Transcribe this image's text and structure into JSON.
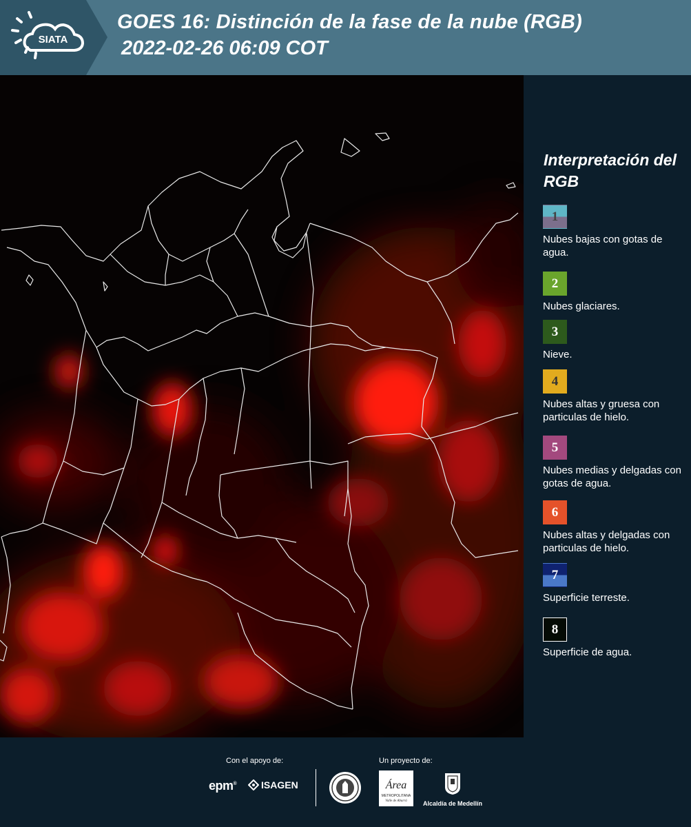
{
  "header": {
    "logo_text": "SIATA",
    "title_line1": "GOES 16: Distinción de la fase de la nube (RGB)",
    "title_line2": "2022-02-26 06:09 COT"
  },
  "legend": {
    "title": "Interpretación del RGB",
    "items": [
      {
        "number": "1",
        "label": "Nubes bajas con gotas de agua.",
        "color_top": "#5fb6c6",
        "color_bottom": "#7c6f8c",
        "number_color": "#444444"
      },
      {
        "number": "2",
        "label": "Nubes glaciares.",
        "color_top": "#6aa52c",
        "color_bottom": "#6aa52c",
        "number_color": "#ffffff"
      },
      {
        "number": "3",
        "label": "Nieve.",
        "color_top": "#2d5a1c",
        "color_bottom": "#2d5a1c",
        "number_color": "#ffffff"
      },
      {
        "number": "4",
        "label": "Nubes altas y gruesa con particulas de hielo.",
        "color_top": "#e2ab1e",
        "color_bottom": "#e2ab1e",
        "number_color": "#333333"
      },
      {
        "number": "5",
        "label": "Nubes medias y delgadas con gotas de agua.",
        "color_top": "#a3497e",
        "color_bottom": "#a3497e",
        "number_color": "#ffffff"
      },
      {
        "number": "6",
        "label": "Nubes altas y delgadas con particulas de hielo.",
        "color_top": "#e5522a",
        "color_bottom": "#e5522a",
        "number_color": "#ffffff"
      },
      {
        "number": "7",
        "label": "Superficie terreste.",
        "color_top": "#0f2270",
        "color_bottom": "#4a78c8",
        "number_color": "#ffffff"
      },
      {
        "number": "8",
        "label": "Superficie de agua.",
        "color_top": "#050b05",
        "color_bottom": "#050b05",
        "number_color": "#ffffff"
      }
    ]
  },
  "footer": {
    "support_label": "Con el apoyo de:",
    "project_label": "Un proyecto de:",
    "epm_text": "epm",
    "isagen_text": "ISAGEN",
    "area_text": "Área",
    "area_sub1": "METROPOLITANA",
    "area_sub2": "Valle de Aburrá",
    "alcaldia_text": "Alcaldía de Medellín"
  },
  "colors": {
    "header_bg": "#4b7588",
    "page_bg": "#0c1e2b",
    "cloud_red": "#ff1a10"
  }
}
